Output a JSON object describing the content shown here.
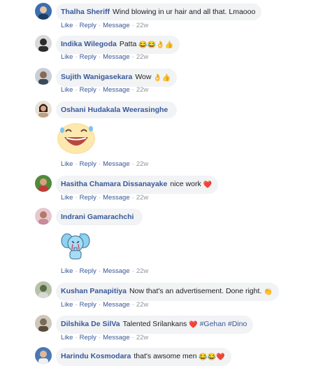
{
  "actions": {
    "like": "Like",
    "reply": "Reply",
    "message": "Message",
    "separator": "·"
  },
  "comments": [
    {
      "author": "Thalha Sheriff",
      "text": "Wind blowing in ur hair and all that. Lmaooo",
      "emoji": "",
      "time": "22w",
      "avatar_color": "#3a6fb0"
    },
    {
      "author": "Indika Wilegoda",
      "text": "Patta",
      "emoji": "😂😂👌👍",
      "time": "22w",
      "avatar_color": "#2b2b2b"
    },
    {
      "author": "Sujith Wanigasekara",
      "text": "Wow",
      "emoji": "👌👍",
      "time": "22w",
      "avatar_color": "#6b7f8e"
    },
    {
      "author": "Oshani Hudakala Weerasinghe",
      "text": "",
      "emoji": "",
      "time": "22w",
      "avatar_color": "#8a5a3c",
      "sticker": "laughing-face-sticker"
    },
    {
      "author": "Hasitha Chamara Dissanayake",
      "text": "nice work",
      "emoji": "❤️",
      "time": "22w",
      "avatar_color": "#4f8a3a"
    },
    {
      "author": "Indrani Gamarachchi",
      "text": "",
      "emoji": "",
      "time": "22w",
      "avatar_color": "#c98a9a",
      "sticker": "crying-elephant-sticker"
    },
    {
      "author": "Kushan Panapitiya",
      "text": "Now that's an advertisement. Done right.",
      "emoji": "👏",
      "time": "22w",
      "avatar_color": "#5a6b4a"
    },
    {
      "author": "Dilshika De SilVa",
      "text": "Talented Srilankans",
      "emoji": "❤️",
      "hashtags": "#Gehan #Dino",
      "time": "22w",
      "avatar_color": "#7a6a5a"
    },
    {
      "author": "Harindu Kosmodara",
      "text": "that's awsome men",
      "emoji": "😂😂❤️",
      "time": "",
      "avatar_color": "#4a78b5"
    }
  ]
}
